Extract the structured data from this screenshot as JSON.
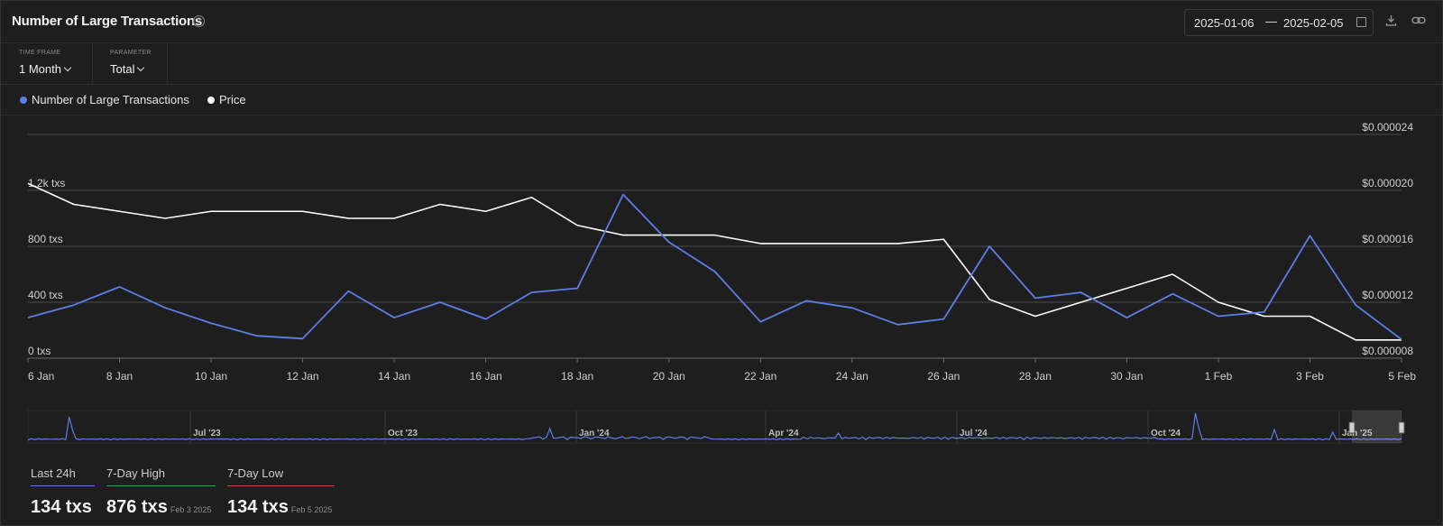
{
  "header": {
    "title": "Number of Large Transactions",
    "date_start": "2025-01-06",
    "date_sep": "—",
    "date_end": "2025-02-05"
  },
  "controls": {
    "timeframe_label": "TIME FRAME",
    "timeframe_value": "1 Month",
    "parameter_label": "PARAMETER",
    "parameter_value": "Total"
  },
  "legend": {
    "series_1": "Number of Large Transactions",
    "series_2": "Price"
  },
  "colors": {
    "transactions": "#5b7ee5",
    "price": "#ffffff",
    "high": "#2e9b4a",
    "low": "#d33a3a"
  },
  "stats": {
    "last24_label": "Last 24h",
    "last24_value": "134 txs",
    "high_label": "7-Day High",
    "high_value": "876 txs",
    "high_date": "Feb 3 2025",
    "low_label": "7-Day Low",
    "low_value": "134 txs",
    "low_date": "Feb 5 2025"
  },
  "chart_data": {
    "type": "line",
    "x": [
      "6 Jan",
      "7 Jan",
      "8 Jan",
      "9 Jan",
      "10 Jan",
      "11 Jan",
      "12 Jan",
      "13 Jan",
      "14 Jan",
      "15 Jan",
      "16 Jan",
      "17 Jan",
      "18 Jan",
      "19 Jan",
      "20 Jan",
      "21 Jan",
      "22 Jan",
      "23 Jan",
      "24 Jan",
      "25 Jan",
      "26 Jan",
      "27 Jan",
      "28 Jan",
      "29 Jan",
      "30 Jan",
      "31 Jan",
      "1 Feb",
      "2 Feb",
      "3 Feb",
      "4 Feb",
      "5 Feb"
    ],
    "x_ticks": [
      "6 Jan",
      "8 Jan",
      "10 Jan",
      "12 Jan",
      "14 Jan",
      "16 Jan",
      "18 Jan",
      "20 Jan",
      "22 Jan",
      "24 Jan",
      "26 Jan",
      "28 Jan",
      "30 Jan",
      "1 Feb",
      "3 Feb",
      "5 Feb"
    ],
    "series": [
      {
        "name": "Number of Large Transactions",
        "axis": "left",
        "values": [
          290,
          380,
          510,
          360,
          250,
          160,
          140,
          480,
          290,
          400,
          280,
          470,
          500,
          1170,
          830,
          620,
          260,
          410,
          360,
          240,
          280,
          800,
          430,
          470,
          290,
          460,
          300,
          330,
          876,
          380,
          134
        ]
      },
      {
        "name": "Price",
        "axis": "right",
        "values": [
          2.05e-05,
          1.9e-05,
          1.85e-05,
          1.8e-05,
          1.85e-05,
          1.85e-05,
          1.85e-05,
          1.8e-05,
          1.8e-05,
          1.9e-05,
          1.85e-05,
          1.95e-05,
          1.75e-05,
          1.68e-05,
          1.68e-05,
          1.68e-05,
          1.62e-05,
          1.62e-05,
          1.62e-05,
          1.62e-05,
          1.65e-05,
          1.22e-05,
          1.1e-05,
          1.2e-05,
          1.3e-05,
          1.4e-05,
          1.2e-05,
          1.1e-05,
          1.1e-05,
          9.3e-06,
          9.3e-06
        ]
      }
    ],
    "y_left": {
      "ticks": [
        "0 txs",
        "400 txs",
        "800 txs",
        "1.2k txs"
      ],
      "ylim": [
        0,
        1600
      ]
    },
    "y_right": {
      "ticks": [
        "$0.000008",
        "$0.000012",
        "$0.000016",
        "$0.000020",
        "$0.000024"
      ],
      "ylim": [
        8e-06,
        2.4e-05
      ]
    },
    "grid": true,
    "navigator": {
      "labels": [
        "Jul '23",
        "Oct '23",
        "Jan '24",
        "Apr '24",
        "Jul '24",
        "Oct '24",
        "Jan '25"
      ]
    }
  }
}
